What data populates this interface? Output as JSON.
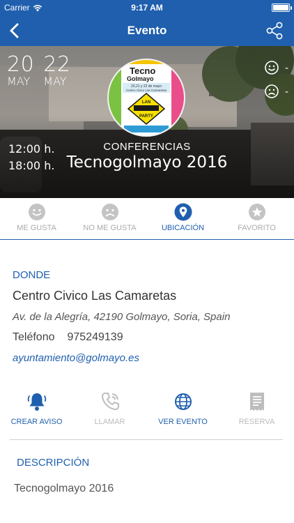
{
  "status_bar": {
    "carrier": "Carrier",
    "time": "9:17 AM",
    "battery_level": 1.0
  },
  "nav": {
    "title": "Evento"
  },
  "event": {
    "start_day": "20",
    "start_month": "MAY",
    "end_day": "22",
    "end_month": "MAY",
    "start_time": "12:00 h.",
    "end_time": "18:00 h.",
    "category": "CONFERENCIAS",
    "title": "Tecnogolmayo 2016",
    "likes": "-",
    "dislikes": "-"
  },
  "poster": {
    "line1": "Tecno",
    "line2": "Golmayo",
    "dates": "20,21 y 22 de mayo",
    "venue": "Centro cívico Las Camaretas",
    "sign_top": "LAN",
    "sign_mid": "PARTY"
  },
  "actions": [
    {
      "label": "ME GUSTA",
      "icon": "smile-icon",
      "active": false
    },
    {
      "label": "NO ME GUSTA",
      "icon": "frown-icon",
      "active": false
    },
    {
      "label": "UBICACIÓN",
      "icon": "location-pin-icon",
      "active": true
    },
    {
      "label": "FAVORITO",
      "icon": "star-icon",
      "active": false
    }
  ],
  "location": {
    "heading": "DONDE",
    "place": "Centro Civico Las Camaretas",
    "address": "Av. de la Alegría, 42190 Golmayo, Soria, Spain",
    "phone_label": "Teléfono",
    "phone": "975249139",
    "email": "ayuntamiento@golmayo.es"
  },
  "tools": [
    {
      "label": "CREAR AVISO",
      "icon": "bell-icon",
      "enabled": true
    },
    {
      "label": "LLAMAR",
      "icon": "phone-icon",
      "enabled": false
    },
    {
      "label": "VER EVENTO",
      "icon": "globe-icon",
      "enabled": true
    },
    {
      "label": "RESERVA",
      "icon": "receipt-icon",
      "enabled": false
    }
  ],
  "description": {
    "heading": "DESCRIPCIÓN",
    "text": "Tecnogolmayo 2016"
  },
  "colors": {
    "brand": "#1f5fae",
    "inactive": "#aaaaaa",
    "text": "#333333"
  }
}
